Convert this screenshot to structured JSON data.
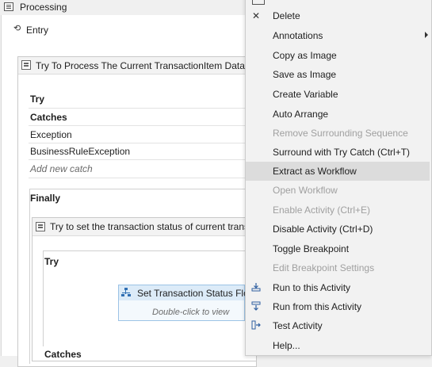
{
  "panel": {
    "title": "Processing",
    "entry_label": "Entry"
  },
  "workflow": {
    "outer_title": "Try To Process The Current TransactionItem Data",
    "try_label": "Try",
    "catches_label": "Catches",
    "catches": [
      {
        "label": "Exception"
      },
      {
        "label": "BusinessRuleException"
      }
    ],
    "add_catch": "Add new catch",
    "finally_label": "Finally",
    "inner_title": "Try to set the transaction status of current transaction",
    "inner_try_label": "Try",
    "inner_catches_label": "Catches",
    "activity": {
      "title": "Set Transaction Status Flow",
      "hint": "Double-click to view"
    }
  },
  "menu": {
    "items": [
      {
        "label": "Delete",
        "icon": "close-icon",
        "disabled": false
      },
      {
        "label": "Annotations",
        "submenu": true,
        "disabled": false
      },
      {
        "label": "Copy as Image",
        "disabled": false
      },
      {
        "label": "Save as Image",
        "disabled": false
      },
      {
        "label": "Create Variable",
        "disabled": false
      },
      {
        "label": "Auto Arrange",
        "disabled": false
      },
      {
        "label": "Remove Surrounding Sequence",
        "disabled": true
      },
      {
        "label": "Surround with Try Catch (Ctrl+T)",
        "disabled": false
      },
      {
        "label": "Extract as Workflow",
        "disabled": false,
        "highlighted": true
      },
      {
        "label": "Open Workflow",
        "disabled": true
      },
      {
        "label": "Enable Activity (Ctrl+E)",
        "disabled": true
      },
      {
        "label": "Disable Activity (Ctrl+D)",
        "disabled": false
      },
      {
        "label": "Toggle Breakpoint",
        "disabled": false
      },
      {
        "label": "Edit Breakpoint Settings",
        "disabled": true
      },
      {
        "label": "Run to this Activity",
        "icon": "run-to-icon",
        "disabled": false
      },
      {
        "label": "Run from this Activity",
        "icon": "run-from-icon",
        "disabled": false
      },
      {
        "label": "Test Activity",
        "icon": "test-activity-icon",
        "disabled": false
      },
      {
        "label": "Help...",
        "disabled": false
      }
    ]
  }
}
